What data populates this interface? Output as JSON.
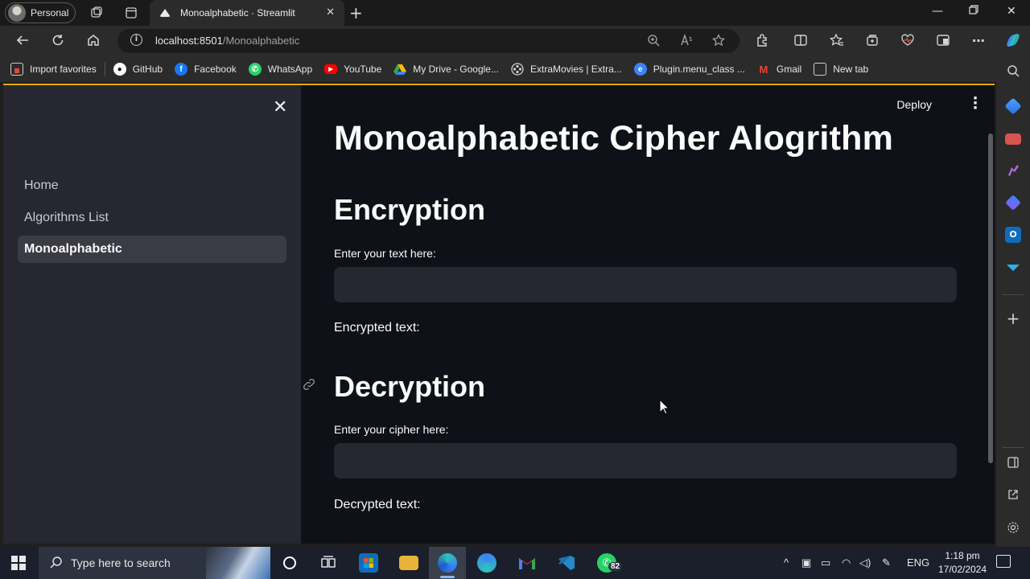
{
  "browser": {
    "profile_label": "Personal",
    "tab_title": "Monoalphabetic · Streamlit",
    "url_host": "localhost:8501",
    "url_path": "/Monoalphabetic"
  },
  "bookmarks": [
    {
      "label": "Import favorites",
      "icon": "import-icon",
      "color": "#e04a3a"
    },
    {
      "label": "GitHub",
      "icon": "github-icon",
      "color": "#ffffff"
    },
    {
      "label": "Facebook",
      "icon": "facebook-icon",
      "color": "#1877f2"
    },
    {
      "label": "WhatsApp",
      "icon": "whatsapp-icon",
      "color": "#25d366"
    },
    {
      "label": "YouTube",
      "icon": "youtube-icon",
      "color": "#ff0000"
    },
    {
      "label": "My Drive - Google...",
      "icon": "drive-icon",
      "color": "#fbbc04"
    },
    {
      "label": "ExtraMovies | Extra...",
      "icon": "film-icon",
      "color": "#cfcfcf"
    },
    {
      "label": "Plugin.menu_class ...",
      "icon": "edge-icon",
      "color": "#3b82f6"
    },
    {
      "label": "Gmail",
      "icon": "gmail-icon",
      "color": "#ea4335"
    },
    {
      "label": "New tab",
      "icon": "newtab-icon",
      "color": "#cfcfcf"
    }
  ],
  "sidebar": {
    "items": [
      {
        "label": "Home",
        "active": false
      },
      {
        "label": "Algorithms List",
        "active": false
      },
      {
        "label": "Monoalphabetic",
        "active": true
      }
    ]
  },
  "main": {
    "deploy_label": "Deploy",
    "title": "Monoalphabetic Cipher Alogrithm",
    "encryption": {
      "heading": "Encryption",
      "input_label": "Enter your text here:",
      "input_value": "",
      "output_label": "Encrypted text:"
    },
    "decryption": {
      "heading": "Decryption",
      "input_label": "Enter your cipher here:",
      "input_value": "",
      "output_label": "Decrypted text:"
    }
  },
  "taskbar": {
    "search_placeholder": "Type here to search",
    "whatsapp_badge": "82",
    "language": "ENG",
    "time": "1:18 pm",
    "date": "17/02/2024"
  },
  "colors": {
    "app_bg": "#0e1117",
    "sidebar_bg": "#262730",
    "input_bg": "#262730",
    "accent_bar": "#e6a800"
  }
}
